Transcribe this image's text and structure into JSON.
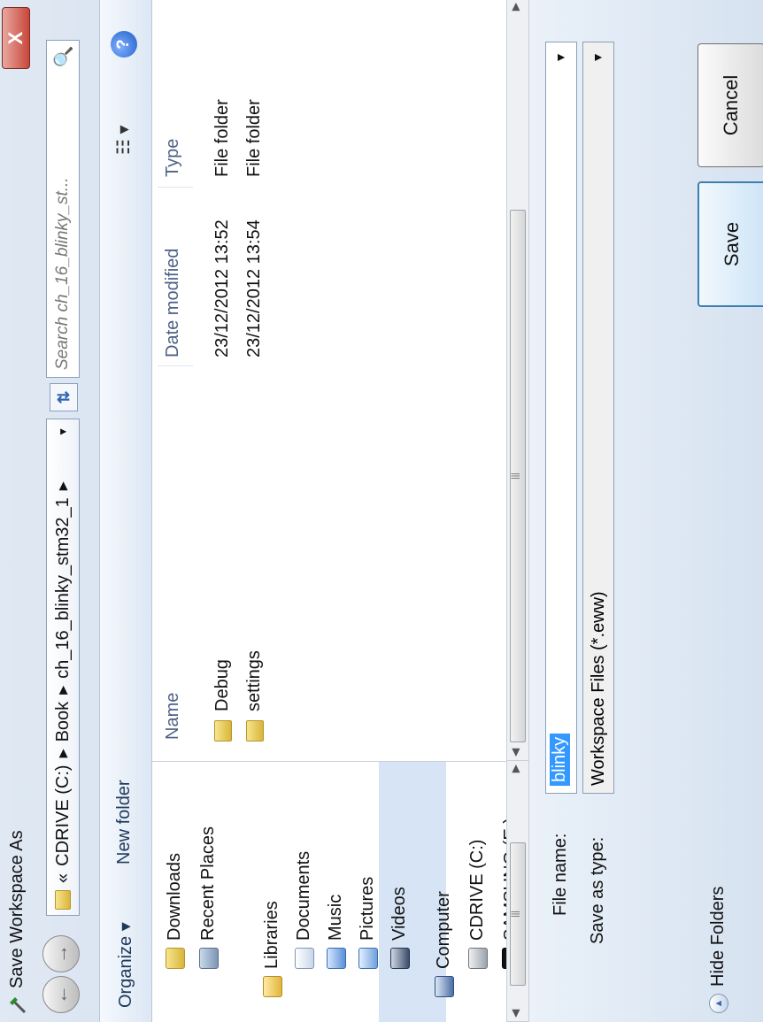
{
  "window": {
    "title": "Save Workspace As",
    "close_label": "X"
  },
  "address": {
    "prefix": "«",
    "crumbs": [
      "CDRIVE (C:)",
      "Book",
      "ch_16_blinky_stm32_1"
    ]
  },
  "search": {
    "placeholder": "Search ch_16_blinky_st..."
  },
  "toolbar": {
    "organize": "Organize ▾",
    "new_folder": "New folder",
    "views_label": "☷ ▾",
    "help": "?"
  },
  "nav": {
    "items": [
      {
        "label": "Downloads",
        "icon": "downloads-icon"
      },
      {
        "label": "Recent Places",
        "icon": "recent-places-icon"
      },
      {
        "label": "Libraries",
        "icon": "libraries-icon"
      },
      {
        "label": "Documents",
        "icon": "documents-icon"
      },
      {
        "label": "Music",
        "icon": "music-icon"
      },
      {
        "label": "Pictures",
        "icon": "pictures-icon"
      },
      {
        "label": "Videos",
        "icon": "videos-icon"
      },
      {
        "label": "Computer",
        "icon": "computer-icon"
      },
      {
        "label": "CDRIVE (C:)",
        "icon": "drive-icon"
      },
      {
        "label": "SAMSUNG (E:)",
        "icon": "usb-drive-icon"
      }
    ]
  },
  "files": {
    "columns": [
      "Name",
      "Date modified",
      "Type"
    ],
    "rows": [
      {
        "name": "Debug",
        "date": "23/12/2012 13:52",
        "type": "File folder"
      },
      {
        "name": "settings",
        "date": "23/12/2012 13:54",
        "type": "File folder"
      }
    ]
  },
  "form": {
    "file_name_label": "File name:",
    "file_name_value": "blinky",
    "save_type_label": "Save as type:",
    "save_type_value": "Workspace Files (*.eww)"
  },
  "buttons": {
    "save": "Save",
    "cancel": "Cancel",
    "hide_folders": "Hide Folders"
  }
}
